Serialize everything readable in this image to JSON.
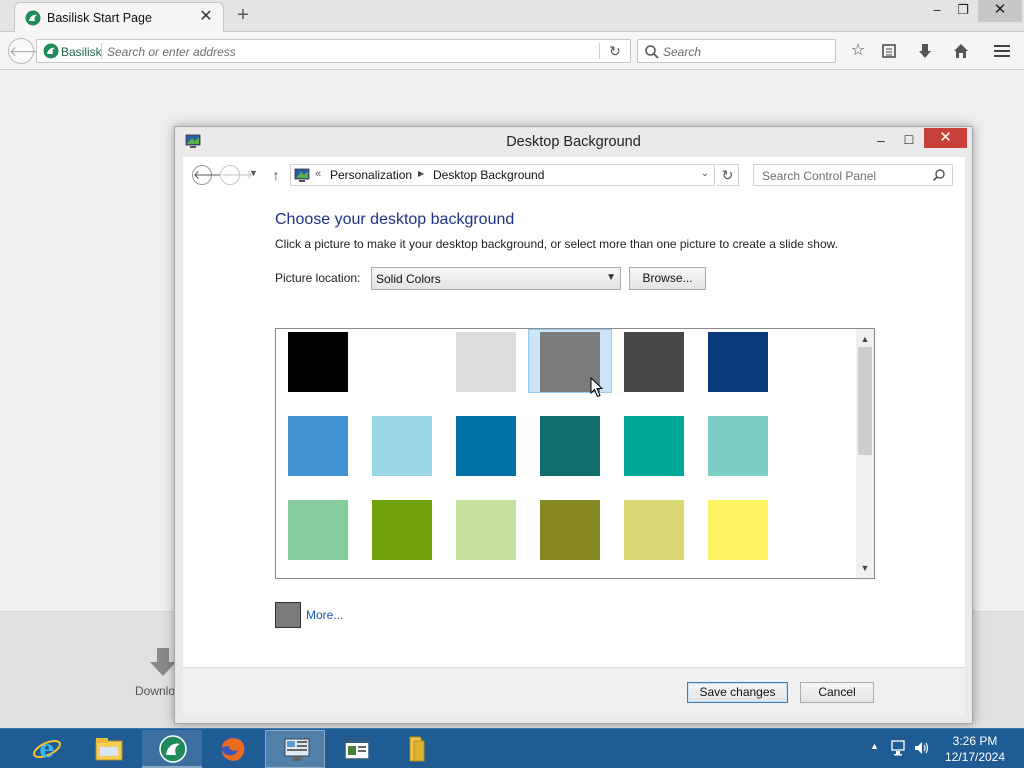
{
  "browser": {
    "tab_title": "Basilisk Start Page",
    "tab_close": "✕",
    "new_tab": "+",
    "window_min": "–",
    "window_restore": "❐",
    "window_close": "✕",
    "identity_label": "Basilisk",
    "address_placeholder": "Search or enter address",
    "search_placeholder": "Search",
    "toolbar_icons": [
      "bookmark-star-icon",
      "reading-list-icon",
      "downloads-icon",
      "home-icon",
      "menu-icon"
    ],
    "download_label": "Downlo"
  },
  "dialog": {
    "title": "Desktop Background",
    "breadcrumbs": [
      "Personalization",
      "Desktop Background"
    ],
    "search_placeholder": "Search Control Panel",
    "heading": "Choose your desktop background",
    "subtext": "Click a picture to make it your desktop background, or select more than one picture to create a slide show.",
    "location_label": "Picture location:",
    "location_value": "Solid Colors",
    "browse_label": "Browse...",
    "more_label": "More...",
    "more_color": "#7b7b7b",
    "save_label": "Save changes",
    "cancel_label": "Cancel",
    "selected_index": 3,
    "swatches": [
      "#000000",
      "#ffffff",
      "#dcdcdc",
      "#7b7b7b",
      "#474747",
      "#0b3a7a",
      "#4193d3",
      "#99d7e7",
      "#0072a5",
      "#106e6e",
      "#00a99a",
      "#7ccfc5",
      "#84cc9b",
      "#6fa20b",
      "#c6e19d",
      "#858920",
      "#d8d771",
      "#fff564"
    ]
  },
  "taskbar": {
    "time": "3:26 PM",
    "date": "12/17/2024",
    "items": [
      "internet-explorer",
      "file-explorer",
      "basilisk",
      "firefox",
      "control-panel",
      "document-viewer",
      "folder"
    ]
  },
  "colors": {
    "accent_link": "#1a55b8",
    "heading": "#1e3287",
    "taskbar": "#1f5c93",
    "close_red": "#c7403a"
  }
}
